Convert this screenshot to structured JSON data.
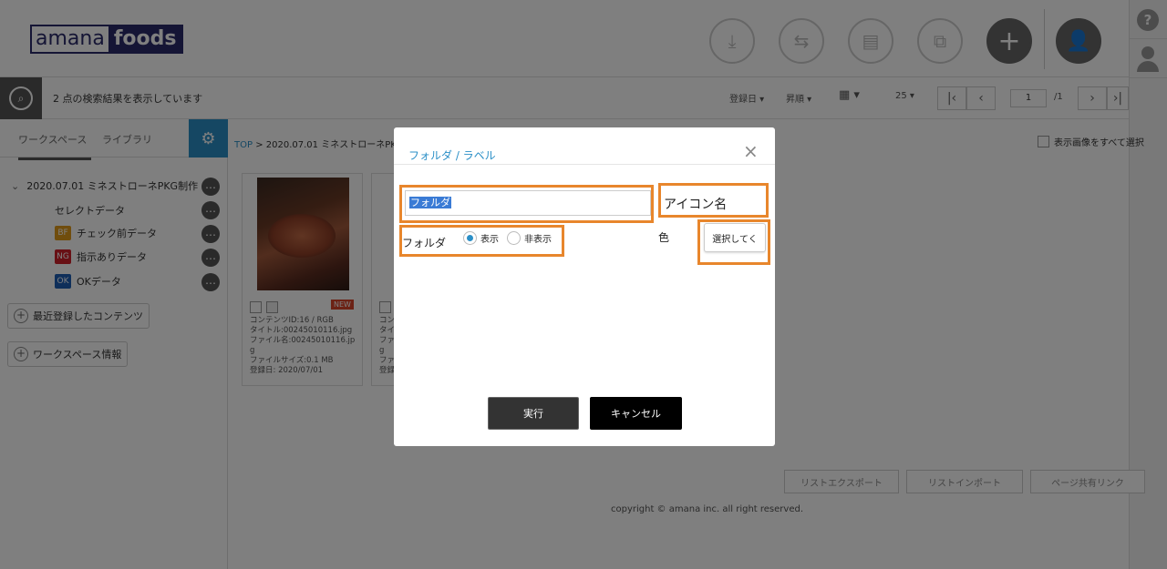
{
  "header": {
    "logo_left": "amana",
    "logo_right": "foods",
    "help_label": "?"
  },
  "searchbar": {
    "result_text": "2 点の検索結果を表示しています",
    "sort_date": "登録日 ▾",
    "sort_order": "昇順 ▾",
    "per_page": "25 ▾",
    "page_current": "1",
    "page_total": "/1"
  },
  "sidebar": {
    "tabs": [
      "ワークスペース",
      "ライブラリ"
    ],
    "tree": [
      {
        "label": "2020.07.01 ミネストローネPKG制作"
      },
      {
        "label": "セレクトデータ"
      },
      {
        "label": "チェック前データ",
        "badge": "BF",
        "badge_color": "#e09a1a"
      },
      {
        "label": "指示ありデータ",
        "badge": "NG",
        "badge_color": "#d0202a"
      },
      {
        "label": "OKデータ",
        "badge": "OK",
        "badge_color": "#1f5fb5"
      }
    ],
    "buttons": [
      "最近登録したコンテンツ",
      "ワークスペース情報"
    ]
  },
  "main": {
    "breadcrumb_top": "TOP",
    "breadcrumb_rest": "> 2020.07.01 ミネストローネPKG制",
    "select_all_label": "表示画像をすべて選択",
    "card1": {
      "new_badge": "NEW",
      "meta": [
        "コンテンツID:16 / RGB",
        "タイトル:00245010116.jpg",
        "ファイル名:00245010116.jp",
        "g",
        "ファイルサイズ:0.1 MB",
        "登録日: 2020/07/01"
      ]
    },
    "card2": {
      "meta": [
        "コン",
        "タイ",
        "ファ",
        "g",
        "ファ",
        "登録"
      ]
    },
    "footer_buttons": [
      "リストエクスポート",
      "リストインポート",
      "ページ共有リンク"
    ],
    "copyright": "copyright © amana inc. all right reserved."
  },
  "modal": {
    "title": "フォルダ / ラベル",
    "close": "×",
    "folder_input_value": "フォルダ",
    "icon_name_label": "アイコン名",
    "visibility_label": "フォルダ",
    "radio_show": "表示",
    "radio_hide": "非表示",
    "color_label": "色",
    "select_button": "選択してく",
    "execute_button": "実行",
    "cancel_button": "キャンセル"
  },
  "colors": {
    "accent": "#2b8fc7",
    "highlight": "#e8862c",
    "logo": "#2b2b6b"
  }
}
